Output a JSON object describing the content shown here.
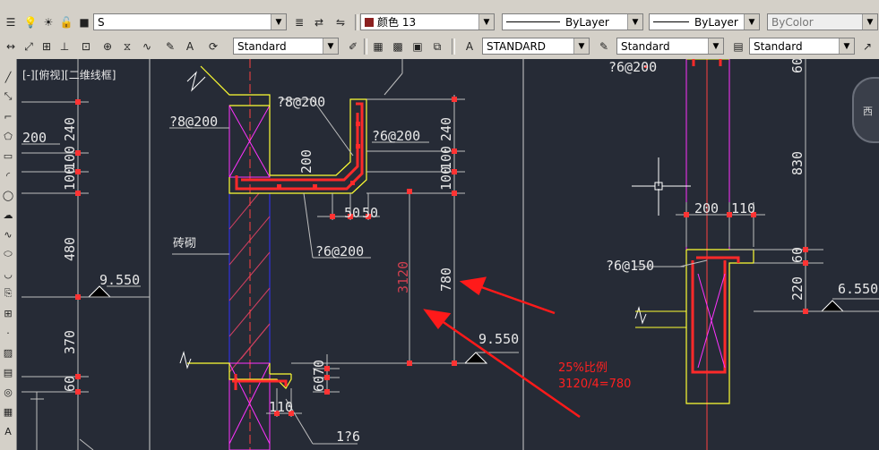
{
  "toolbar1": {
    "layer_name": "S",
    "color_label": "颜色 13",
    "linetype": "ByLayer",
    "lineweight": "ByLayer",
    "plotstyle": "ByColor"
  },
  "toolbar2": {
    "text_style": "Standard",
    "dim_style": "STANDARD",
    "table_style": "Standard",
    "mleader_style": "Standard"
  },
  "viewport": {
    "label": "[-][俯视][二维线框]"
  },
  "drawing_texts": {
    "t_7_8_200_left": "?8@200",
    "t_7_8_200_mid": "?8@200",
    "t_6_200_right": "?6@200",
    "t_6_200_bottom": "?6@200",
    "t_6_200_top_right": "?6@200",
    "t_6_150": "?6@150",
    "t_1_6": "1?6",
    "t_200_left": "200",
    "brick": "砖砌",
    "d240a": "240",
    "d100a": "100",
    "d100b": "100",
    "d480": "480",
    "d370": "370",
    "d60a": "60",
    "d200": "200",
    "d240b": "240",
    "d100c": "100",
    "d100d": "100",
    "d50a": "50",
    "d50b": "50",
    "d3120": "3120",
    "d780": "780",
    "d70": "70",
    "d60b": "60",
    "d110a": "110",
    "d830": "830",
    "d200b": "200",
    "d110b": "110",
    "d60c": "60",
    "d220": "220",
    "d60top": "60",
    "elev_9550a": "9.550",
    "elev_9550b": "9.550",
    "elev_6550": "6.550",
    "compass": "西"
  },
  "annotation": {
    "line1": "25%比例",
    "line2": "3120/4=780"
  },
  "colors": {
    "canvas_bg": "#262b36",
    "rebar": "#ff2a2a",
    "outline": "#ffff33",
    "dim": "#c8c8c8",
    "tick": "#ff3333",
    "magenta": "#ff33ff",
    "blue": "#3333ff"
  }
}
